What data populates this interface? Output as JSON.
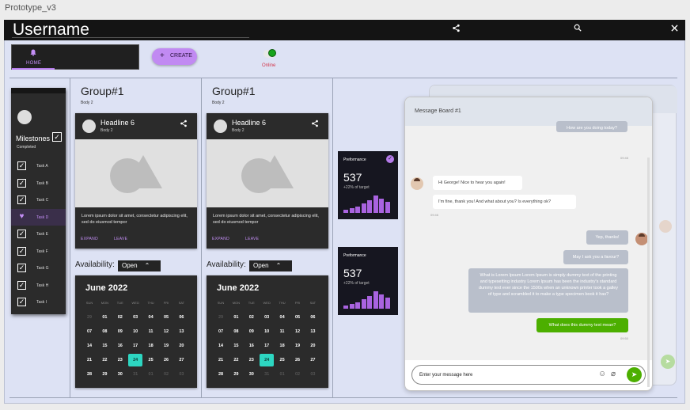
{
  "window": {
    "title": "Prototype_v3"
  },
  "topbar": {
    "username": "Username",
    "share_icon": "share-icon",
    "search_icon": "search-icon",
    "close_icon": "close-icon"
  },
  "nav": {
    "home_label": "HOME",
    "create_label": "CREATE",
    "status_label": "Online",
    "status_color": "#17a31b"
  },
  "sidebar": {
    "title": "Milestones",
    "subtitle": "Completed",
    "tasks": [
      {
        "label": "Task A",
        "checked": true
      },
      {
        "label": "Task B",
        "checked": true
      },
      {
        "label": "Task C",
        "checked": true
      },
      {
        "label": "Task D",
        "checked": false,
        "selected": true
      },
      {
        "label": "Task E",
        "checked": true
      },
      {
        "label": "Task F",
        "checked": true
      },
      {
        "label": "Task G",
        "checked": true
      },
      {
        "label": "Task H",
        "checked": true
      },
      {
        "label": "Task I",
        "checked": true
      }
    ]
  },
  "groups": [
    {
      "title": "Group#1",
      "body": "Body 2",
      "card": {
        "headline": "Headline 6",
        "sub": "Body 2",
        "text": "Lorem ipsum dolor sit amet, consectetur adipiscing elit, sed do eiusmod tempor",
        "expand": "EXPAND",
        "leave": "LEAVE"
      },
      "availability_label": "Availability:",
      "availability_value": "Open"
    },
    {
      "title": "Group#1",
      "body": "Body 2",
      "card": {
        "headline": "Headline 6",
        "sub": "Body 2",
        "text": "Lorem ipsum dolor sit amet, consectetur adipiscing elit, sed do eiusmod tempor",
        "expand": "EXPAND",
        "leave": "LEAVE"
      },
      "availability_label": "Availability:",
      "availability_value": "Open"
    }
  ],
  "calendar": {
    "month": "June 2022",
    "weekdays": [
      "SUN",
      "MON",
      "TUE",
      "WED",
      "THU",
      "FRI",
      "SAT"
    ],
    "weeks": [
      [
        "29",
        "01",
        "02",
        "03",
        "04",
        "05",
        "06"
      ],
      [
        "07",
        "08",
        "09",
        "10",
        "11",
        "12",
        "13"
      ],
      [
        "14",
        "15",
        "16",
        "17",
        "18",
        "19",
        "20"
      ],
      [
        "21",
        "22",
        "23",
        "24",
        "25",
        "26",
        "27"
      ],
      [
        "28",
        "29",
        "30",
        "31",
        "01",
        "02",
        "03"
      ]
    ],
    "today": "24"
  },
  "performance": [
    {
      "title": "Preformance",
      "value": "537",
      "sub": "+22% of target",
      "bars": [
        2,
        3,
        4,
        6,
        8,
        11,
        9,
        7
      ],
      "checked": true
    },
    {
      "title": "Preformance",
      "value": "537",
      "sub": "+22% of target",
      "bars": [
        2,
        3,
        4,
        6,
        8,
        11,
        9,
        7
      ],
      "checked": false
    }
  ],
  "messages": {
    "title": "Message Board #1",
    "top_fragment": "How are you doing today?",
    "top_time": "09:45",
    "in_1": "Hi George! Nice to hear you again!",
    "in_2": "I'm fine, thank you! And what about you? Is everything ok?",
    "in_time": "09:46",
    "out_1": "Yep, thanks!",
    "out_2": "May I ask you a favour?",
    "out_3": "What is Lorem Ipsum Lorem Ipsum is simply dummy text of the printing and typesetting industry Lorem Ipsum has been the industry's standard dummy text ever since the 1500s when an unknown printer took a galley of type and scrambled it to make a type specimen book it has?",
    "out_4": "What does this dummy text mean?",
    "out_time": "09:50",
    "input_placeholder": "Enter your message here"
  },
  "colors": {
    "accent": "#b57bea",
    "today": "#2dd6c1",
    "send": "#4caf00",
    "background": "#dde2f4"
  }
}
